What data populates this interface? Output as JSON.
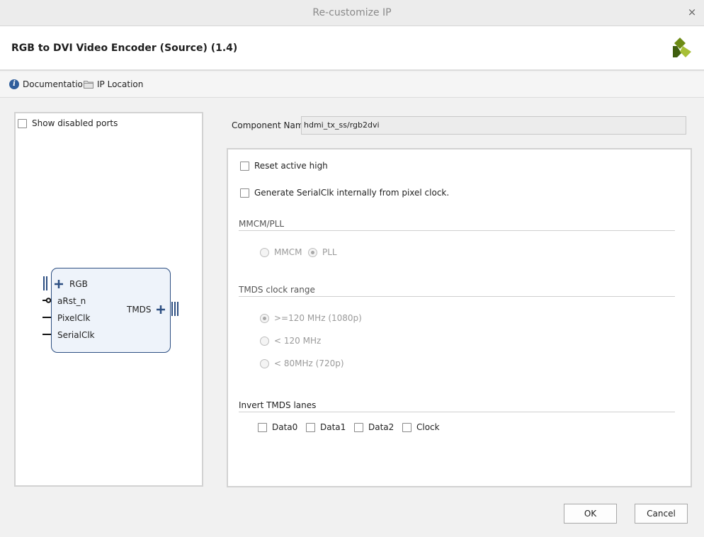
{
  "window": {
    "title": "Re-customize IP",
    "close_symbol": "×"
  },
  "header": {
    "ip_title": "RGB to DVI Video Encoder (Source) (1.4)"
  },
  "toolbar": {
    "documentation": "Documentation",
    "ip_location": "IP Location"
  },
  "left_panel": {
    "show_disabled_ports": {
      "label": "Show disabled ports",
      "checked": false
    },
    "block": {
      "inputs": [
        "RGB",
        "aRst_n",
        "PixelClk",
        "SerialClk"
      ],
      "output": "TMDS"
    }
  },
  "component": {
    "label": "Component Name",
    "value": "hdmi_tx_ss/rgb2dvi"
  },
  "options": {
    "reset_active_high": {
      "label": "Reset active high",
      "checked": false
    },
    "generate_serialclk": {
      "label": "Generate SerialClk internally from pixel clock.",
      "checked": false
    }
  },
  "mmcm_pll": {
    "title": "MMCM/PLL",
    "options": [
      {
        "label": "MMCM",
        "selected": false
      },
      {
        "label": "PLL",
        "selected": true
      }
    ]
  },
  "tmds_clock_range": {
    "title": "TMDS clock range",
    "options": [
      {
        "label": ">=120 MHz (1080p)",
        "selected": true
      },
      {
        "label": "< 120 MHz",
        "selected": false
      },
      {
        "label": "< 80MHz (720p)",
        "selected": false
      }
    ]
  },
  "invert_tmds": {
    "title": "Invert TMDS lanes",
    "lanes": [
      {
        "label": "Data0",
        "checked": false
      },
      {
        "label": "Data1",
        "checked": false
      },
      {
        "label": "Data2",
        "checked": false
      },
      {
        "label": "Clock",
        "checked": false
      }
    ]
  },
  "buttons": {
    "ok": "OK",
    "cancel": "Cancel"
  },
  "colors": {
    "accent": "#2f5e9c",
    "block_border": "#2d4f82",
    "block_fill": "#eef3fa"
  }
}
